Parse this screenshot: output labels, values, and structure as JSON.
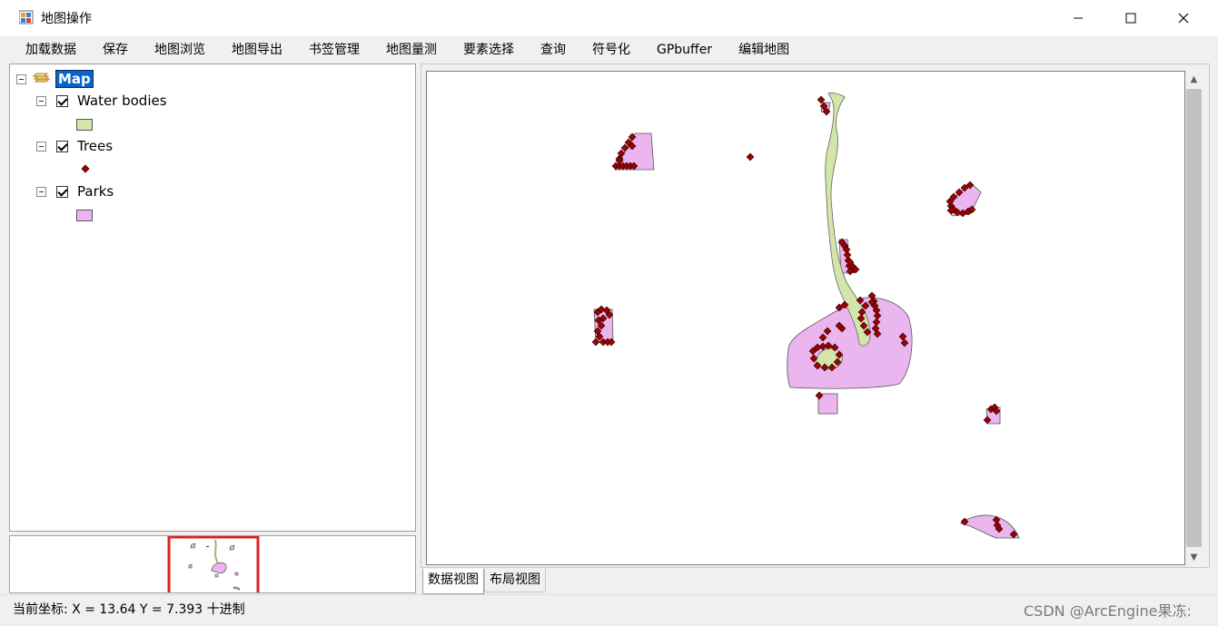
{
  "window": {
    "title": "地图操作",
    "icon": "app-map-icon"
  },
  "menu": [
    "加载数据",
    "保存",
    "地图浏览",
    "地图导出",
    "书签管理",
    "地图量测",
    "要素选择",
    "查询",
    "符号化",
    "GPbuffer",
    "编辑地图"
  ],
  "toc": {
    "root": "Map",
    "layers": [
      {
        "name": "Water bodies",
        "checked": true,
        "symbol": "polygon",
        "color": "#d3e5a8"
      },
      {
        "name": "Trees",
        "checked": true,
        "symbol": "point",
        "color": "#a50000"
      },
      {
        "name": "Parks",
        "checked": true,
        "symbol": "polygon",
        "color": "#ebb5ef"
      }
    ]
  },
  "tabs": [
    {
      "label": "数据视图",
      "active": true
    },
    {
      "label": "布局视图",
      "active": false
    }
  ],
  "status": {
    "coordinates": "当前坐标:  X = 13.64 Y = 7.393 十进制"
  },
  "watermark": "CSDN @ArcEngine果冻:",
  "colors": {
    "park_fill": "#ebb5ef",
    "water_fill": "#d3e5a8",
    "tree_fill": "#a50000",
    "selection": "#0a64c8",
    "extent_box": "#e02020"
  }
}
